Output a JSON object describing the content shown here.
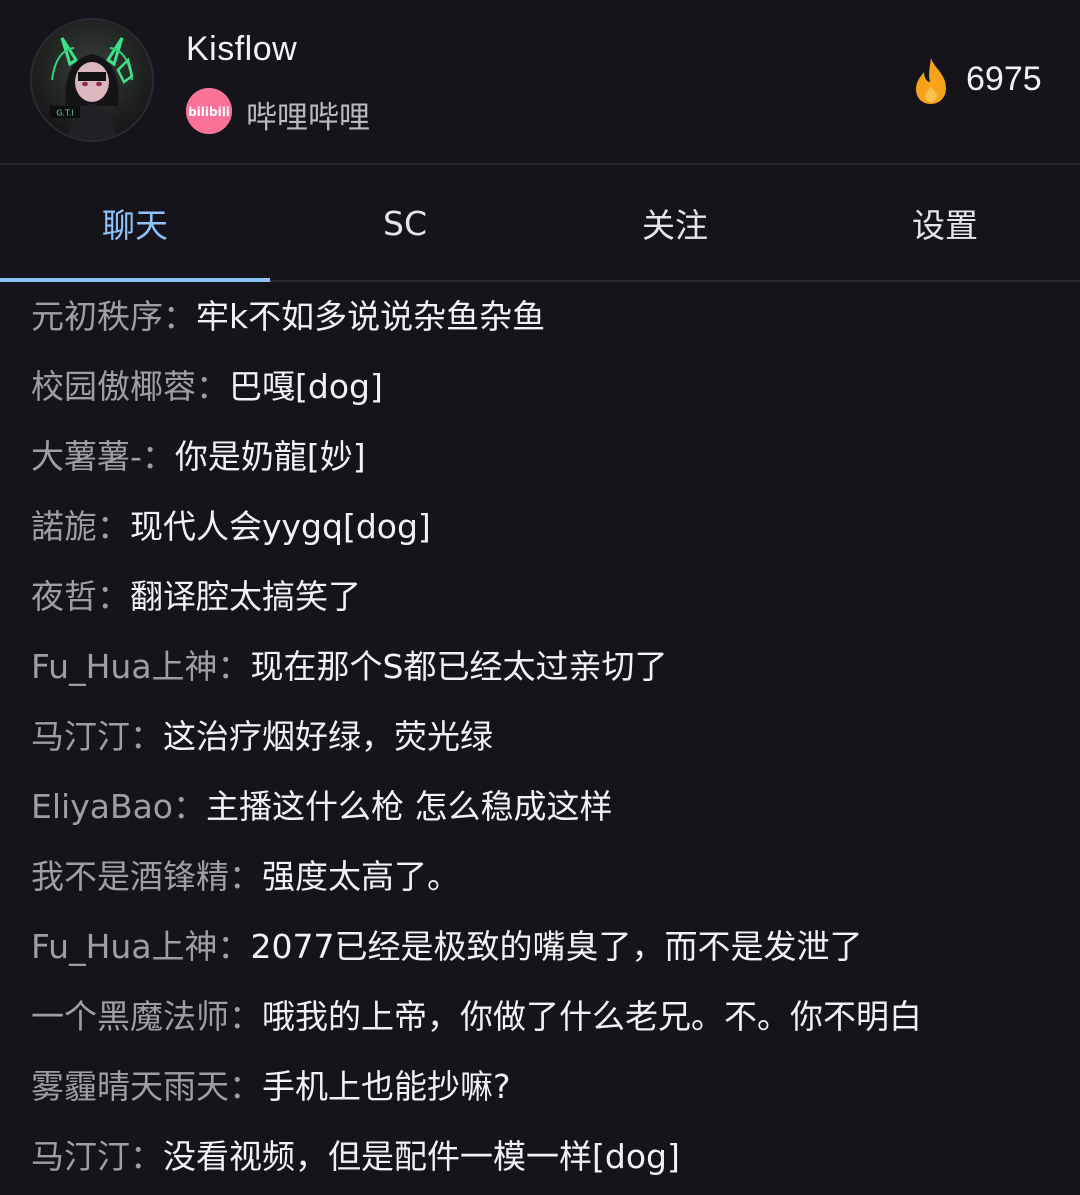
{
  "header": {
    "streamer_name": "Kisflow",
    "platform_name": "哔哩哔哩",
    "platform_logo_text": "bilibili",
    "avatar_badge": "G.T.I",
    "popularity": "6975",
    "popularity_icon": "flame-icon"
  },
  "tabs": [
    {
      "label": "聊天",
      "active": true
    },
    {
      "label": "SC",
      "active": false
    },
    {
      "label": "关注",
      "active": false
    },
    {
      "label": "设置",
      "active": false
    }
  ],
  "colors": {
    "background": "#16141b",
    "accent": "#8ec2ff",
    "username": "#9e9ea6",
    "message": "#f2f2f4",
    "bilibili_pink": "#fb7299",
    "flame": "#f6a21a"
  },
  "chat": {
    "separator": "：",
    "messages": [
      {
        "user": "元初秩序",
        "text": "牢k不如多说说杂鱼杂鱼"
      },
      {
        "user": "校园傲椰蓉",
        "text": "巴嘎[dog]"
      },
      {
        "user": "大薯薯-",
        "text": "你是奶龍[妙]"
      },
      {
        "user": "諾旎",
        "text": "现代人会yygq[dog]"
      },
      {
        "user": "夜哲",
        "text": "翻译腔太搞笑了"
      },
      {
        "user": "Fu_Hua上神",
        "text": "现在那个S都已经太过亲切了"
      },
      {
        "user": "马汀汀",
        "text": "这治疗烟好绿，荧光绿"
      },
      {
        "user": "EliyaBao",
        "text": "主播这什么枪 怎么稳成这样"
      },
      {
        "user": "我不是酒锋精",
        "text": "强度太高了。"
      },
      {
        "user": "Fu_Hua上神",
        "text": "2077已经是极致的嘴臭了，而不是发泄了"
      },
      {
        "user": "一个黑魔法师",
        "text": "哦我的上帝，你做了什么老兄。不。你不明白"
      },
      {
        "user": "雾霾晴天雨天",
        "text": "手机上也能抄嘛?"
      },
      {
        "user": "马汀汀",
        "text": "没看视频，但是配件一模一样[dog]"
      }
    ]
  }
}
